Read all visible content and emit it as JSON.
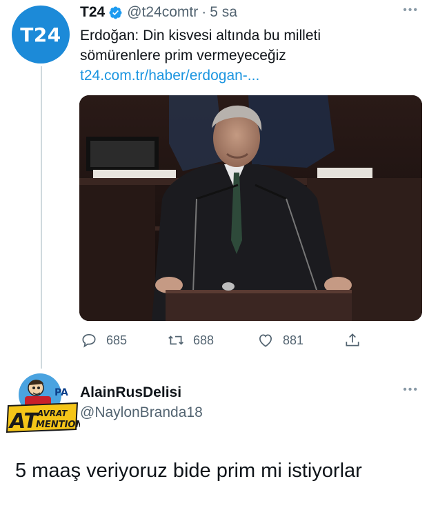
{
  "tweet": {
    "avatar_text": "T24",
    "name": "T24",
    "handle": "@t24comtr",
    "separator": "·",
    "time": "5 sa",
    "more": "•••",
    "text_line1": "Erdoğan: Din kisvesi altında bu milleti",
    "text_line2": "sömürenlere prim vermeyeceğiz",
    "link": "t24.com.tr/haber/erdogan-...",
    "actions": {
      "reply_count": "685",
      "retweet_count": "688",
      "like_count": "881"
    }
  },
  "reply": {
    "avatar_badge_top": "PA",
    "avatar_badge_main": "AT",
    "avatar_badge_line1": "AVRAT",
    "avatar_badge_line2": "MENTION",
    "name": "AlainRusDelisi",
    "handle": "@NaylonBranda18",
    "more": "•••",
    "text": "5 maaş veriyoruz bide prim mi istiyorlar"
  },
  "colors": {
    "link": "#1b95e0",
    "avatar_blue": "#1c8ad8",
    "muted": "#536471"
  }
}
